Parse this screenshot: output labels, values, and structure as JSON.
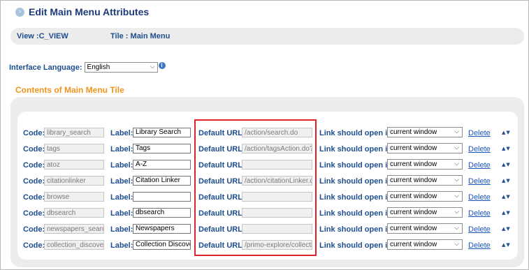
{
  "header": {
    "title": "Edit Main Menu Attributes",
    "icon": "chevron-right-circle-icon"
  },
  "info": {
    "view": "View :C_VIEW",
    "tile": "Tile : Main Menu"
  },
  "language": {
    "label": "Interface Language:",
    "value": "English"
  },
  "section_title": "Contents of Main Menu Tile",
  "labels": {
    "code": "Code:",
    "label": "Label:",
    "default_url": "Default URL:",
    "open_in": "Link should open in:",
    "delete": "Delete",
    "move_arrows": "▲▼"
  },
  "rows": [
    {
      "code": "library_search",
      "label": "Library Search",
      "url": "/action/search.do",
      "open_in": "current window"
    },
    {
      "code": "tags",
      "label": "Tags",
      "url": "/action/tagsAction.do?fn=",
      "open_in": "current window"
    },
    {
      "code": "atoz",
      "label": "A-Z",
      "url": "",
      "open_in": "current window"
    },
    {
      "code": "citationlinker",
      "label": "Citation Linker",
      "url": "/action/citationLinker.do?",
      "open_in": "current window"
    },
    {
      "code": "browse",
      "label": "",
      "url": "",
      "open_in": "current window"
    },
    {
      "code": "dbsearch",
      "label": "dbsearch",
      "url": "",
      "open_in": "current window"
    },
    {
      "code": "newspapers_search",
      "label": "Newspapers",
      "url": "",
      "open_in": "current window"
    },
    {
      "code": "collection_discovery",
      "label": "Collection Discovery",
      "url": "/primo-explore/collection",
      "open_in": "current window"
    }
  ],
  "colors": {
    "accent_orange": "#f0941d",
    "label_blue": "#1d4e8f",
    "title_navy": "#1c3a7a",
    "highlight_red": "#e0222a"
  }
}
